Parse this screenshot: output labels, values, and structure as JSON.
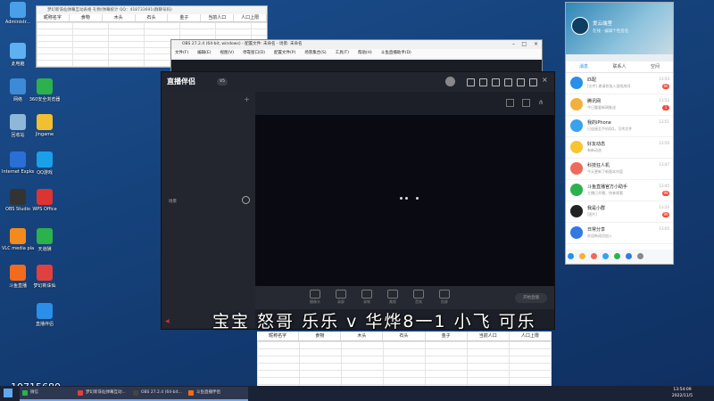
{
  "desktop": {
    "icons": [
      {
        "label": "Administr..."
      },
      {
        "label": "此电脑"
      },
      {
        "label": "网络"
      },
      {
        "label": "回收站"
      },
      {
        "label": "Internet Explorer"
      },
      {
        "label": "OBS Studio"
      },
      {
        "label": "VLC media player"
      },
      {
        "label": "斗鱼直播"
      },
      {
        "label": "360安全浏览器"
      },
      {
        "label": "Jingame"
      },
      {
        "label": "QQ游戏"
      },
      {
        "label": "WPS Office"
      },
      {
        "label": "天道酬"
      },
      {
        "label": "梦幻新诛仙"
      },
      {
        "label": "直播伴侣"
      }
    ],
    "counter": "10715680"
  },
  "excel_top": {
    "title": "梦幻新诛仙弹幕互动表格  礼物/弹幕统计  QQ：418733691(群聊号码)",
    "headers": [
      "昵称名字",
      "食物",
      "木头",
      "石头",
      "金子",
      "当前人口",
      "人口上限"
    ]
  },
  "obs": {
    "title": "OBS 27.2.4 (64-bit, windows) - 配置文件: 未命名 - 场景: 未命名",
    "menu": [
      "文件(F)",
      "编辑(E)",
      "视图(V)",
      "停靠窗口(D)",
      "配置文件(P)",
      "场景集合(S)",
      "工具(T)",
      "帮助(H)",
      "斗鱼直播助手(D)"
    ]
  },
  "douyu": {
    "logo": "直播伴侣",
    "version": "V5",
    "scene_label": "场景",
    "go_live": "开始直播",
    "tools": [
      "摄像头",
      "录屏",
      "录制",
      "美颜",
      "音效",
      "投屏"
    ]
  },
  "excel_bottom": {
    "headers": [
      "昵称名字",
      "食物",
      "木头",
      "石头",
      "金子",
      "当前人口",
      "人口上限"
    ]
  },
  "caption": "宝宝 怒哥 乐乐 v 华烨8一1 小飞 可乐",
  "qq": {
    "name": "爱云端里",
    "status": "在线 · 编辑个性签名",
    "tabs": [
      "消息",
      "联系人",
      "空间"
    ],
    "items": [
      {
        "name": "匹配",
        "preview": "[文件] 邀请你加入游戏房间",
        "time": "13:54",
        "badge": "66",
        "color": "#2a8fe8"
      },
      {
        "name": "腾讯网",
        "preview": "今日重要新闻推送",
        "time": "13:52",
        "badge": "1",
        "color": "#f2b13c"
      },
      {
        "name": "我的iPhone",
        "preview": "已连接至手机QQ，可传文件",
        "time": "13:51",
        "badge": "",
        "color": "#37a2f0"
      },
      {
        "name": "好友动态",
        "preview": "有新动态",
        "time": "13:50",
        "badge": "",
        "color": "#f7c531"
      },
      {
        "name": "科技狂人机",
        "preview": "今天更新了新版本内容",
        "time": "13:47",
        "badge": "",
        "color": "#ee6b5b"
      },
      {
        "name": "斗鱼直播官方小助手",
        "preview": "主播已开播，快来观看",
        "time": "13:45",
        "badge": "99",
        "color": "#2bb24c"
      },
      {
        "name": "我是小群",
        "preview": "[图片]",
        "time": "13:20",
        "badge": "99",
        "color": "#222222"
      },
      {
        "name": "日常分享",
        "preview": "欢迎新成员加入",
        "time": "13:05",
        "badge": "",
        "color": "#3479e2"
      }
    ]
  },
  "taskbar": {
    "items": [
      {
        "label": "微信",
        "color": "#2bb24c"
      },
      {
        "label": "梦幻新诛仙弹幕互动...",
        "color": "#e04040"
      },
      {
        "label": "OBS 27.2.4 (64-bit...",
        "color": "#444"
      },
      {
        "label": "斗鱼直播伴侣",
        "color": "#f26b1d"
      }
    ],
    "time": "13:54:09",
    "date": "2022/11/5"
  }
}
